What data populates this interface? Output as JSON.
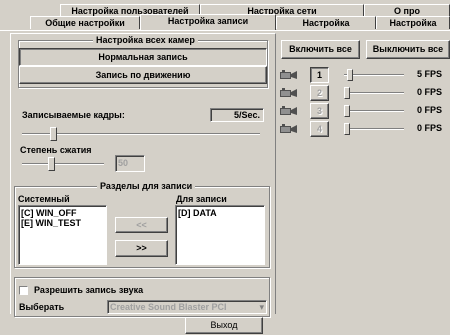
{
  "tabs_row1": [
    {
      "label": "Настройка пользователей"
    },
    {
      "label": "Настройка сети"
    },
    {
      "label": "О про"
    }
  ],
  "tabs_row2": [
    {
      "label": "Общие настройки"
    },
    {
      "label": "Настройка записи",
      "active": true
    },
    {
      "label": "Настройка"
    },
    {
      "label": "Настройка"
    }
  ],
  "all_cams": {
    "title": "Настройка всех камер",
    "normal_label": "Нормальная запись",
    "motion_label": "Запись по движению"
  },
  "frames": {
    "label": "Записываемые кадры:",
    "value": "5/Sec.",
    "level": 0.12
  },
  "compression": {
    "label": "Степень сжатия",
    "value": "50",
    "level": 0.35
  },
  "sections": {
    "title": "Разделы для записи",
    "system_label": "Системный",
    "system_items": [
      "[C] WIN_OFF",
      "[E] WIN_TEST"
    ],
    "record_label": "Для записи",
    "record_items": [
      "[D] DATA"
    ],
    "left_arrow": "<<",
    "right_arrow": ">>"
  },
  "audio": {
    "checkbox_label": "Разрешить запись звука",
    "select_label": "Выберать",
    "device": "Creative Sound Blaster PCI"
  },
  "toolbar": {
    "enable_all": "Включить все",
    "disable_all": "Выключить все"
  },
  "cameras": [
    {
      "num": "1",
      "fps": "5 FPS",
      "enabled": true,
      "level": 0.05
    },
    {
      "num": "2",
      "fps": "0 FPS",
      "enabled": false,
      "level": 0.0
    },
    {
      "num": "3",
      "fps": "0 FPS",
      "enabled": false,
      "level": 0.0
    },
    {
      "num": "4",
      "fps": "0 FPS",
      "enabled": false,
      "level": 0.0
    }
  ],
  "exit_label": "Выход"
}
